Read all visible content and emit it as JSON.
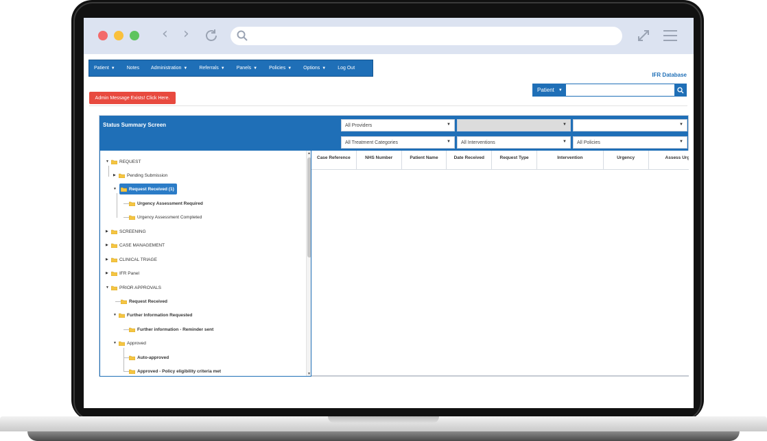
{
  "menu": {
    "items": [
      {
        "label": "Patient",
        "caret": "▼"
      },
      {
        "label": "Notes",
        "caret": ""
      },
      {
        "label": "Administration",
        "caret": "▼"
      },
      {
        "label": "Referrals",
        "caret": "▼"
      },
      {
        "label": "Panels",
        "caret": "▼"
      },
      {
        "label": "Policies",
        "caret": "▼"
      },
      {
        "label": "Options",
        "caret": "▼"
      },
      {
        "label": "Log Out",
        "caret": ""
      }
    ]
  },
  "header": {
    "app_title": "IFR Database"
  },
  "search": {
    "type_label": "Patient",
    "value": "",
    "placeholder": ""
  },
  "admin_message": "Admin Message Exists! Click Here.",
  "panel": {
    "title": "Status Summary Screen",
    "filters": {
      "providers": "All Providers",
      "blank_disabled": "",
      "blank": "",
      "treatment_categories": "All Treatment Categories",
      "interventions": "All Interventions",
      "policies": "All Policies"
    }
  },
  "tree": {
    "request": "REQUEST",
    "pending_submission": "Pending Submission",
    "request_received": "Request Received (1)",
    "urgency_required": "Urgency Assessment Required",
    "urgency_completed": "Urgency Assessment Completed",
    "screening": "SCREENING",
    "case_management": "CASE MANAGEMENT",
    "clinical_triage": "CLINICAL TRIAGE",
    "ifr_panel": "IFR Panel",
    "prior_approvals": "PRIOR APPROVALS",
    "pa_request_received": "Request Received",
    "further_info_requested": "Further Information Requested",
    "further_info_reminder": "Further information - Reminder sent",
    "approved": "Approved",
    "auto_approved": "Auto-approved",
    "approved_policy": "Approved - Policy eligibility criteria met"
  },
  "grid": {
    "columns": [
      "Case Reference",
      "NHS Number",
      "Patient Name",
      "Date Received",
      "Request Type",
      "Intervention",
      "Urgency",
      "Assess Urgen"
    ]
  },
  "colors": {
    "brand_blue": "#1f6fb7",
    "alert_red": "#e84a3f",
    "folder_yellow": "#f5c542"
  }
}
